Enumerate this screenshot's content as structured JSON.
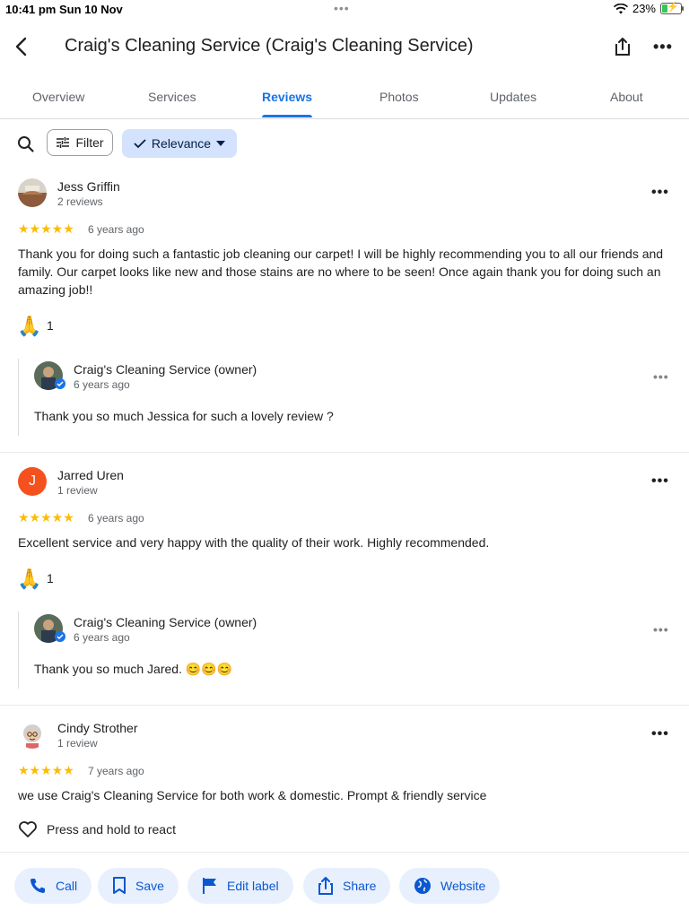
{
  "status_bar": {
    "time_date": "10:41 pm  Sun 10 Nov",
    "dots": "•••",
    "battery_pct": "23%"
  },
  "header": {
    "title": "Craig's Cleaning Service (Craig's Cleaning Service)"
  },
  "tabs": [
    {
      "label": "Overview"
    },
    {
      "label": "Services"
    },
    {
      "label": "Reviews"
    },
    {
      "label": "Photos"
    },
    {
      "label": "Updates"
    },
    {
      "label": "About"
    }
  ],
  "toolbar": {
    "filter_label": "Filter",
    "relevance_label": "Relevance"
  },
  "reviews": [
    {
      "name": "Jess Griffin",
      "count": "2 reviews",
      "stars": "★★★★★",
      "when": "6 years ago",
      "text": "Thank you for doing such a fantastic job cleaning our carpet! I will be highly recommending you to all our friends and family. Our carpet looks like new and those stains are no where to be seen! Once again thank you for doing such an amazing job!!",
      "reaction_emoji": "🙏",
      "reaction_count": "1",
      "owner": {
        "name": "Craig's Cleaning Service (owner)",
        "when": "6 years ago",
        "text": "Thank you so much Jessica for such a lovely review ?"
      }
    },
    {
      "name": "Jarred Uren",
      "initial": "J",
      "count": "1 review",
      "stars": "★★★★★",
      "when": "6 years ago",
      "text": "Excellent service and very happy with the quality of their work. Highly recommended.",
      "reaction_emoji": "🙏",
      "reaction_count": "1",
      "owner": {
        "name": "Craig's Cleaning Service (owner)",
        "when": "6 years ago",
        "text": "Thank you so much Jared. 😊😊😊"
      }
    },
    {
      "name": "Cindy Strother",
      "count": "1 review",
      "stars": "★★★★★",
      "when": "7 years ago",
      "text": "we use Craig's Cleaning Service for both work & domestic. Prompt & friendly service",
      "react_prompt": "Press and hold to react"
    }
  ],
  "actions": [
    {
      "label": "Call",
      "icon": "phone-icon"
    },
    {
      "label": "Save",
      "icon": "bookmark-icon"
    },
    {
      "label": "Edit label",
      "icon": "flag-icon"
    },
    {
      "label": "Share",
      "icon": "share-icon"
    },
    {
      "label": "Website",
      "icon": "globe-icon"
    }
  ],
  "colors": {
    "accent": "#1a73e8",
    "star": "#fbbc04",
    "chip_bg": "#e8f0fe",
    "relevance_bg": "#d3e3fd",
    "avatar_j": "#f4511e"
  }
}
